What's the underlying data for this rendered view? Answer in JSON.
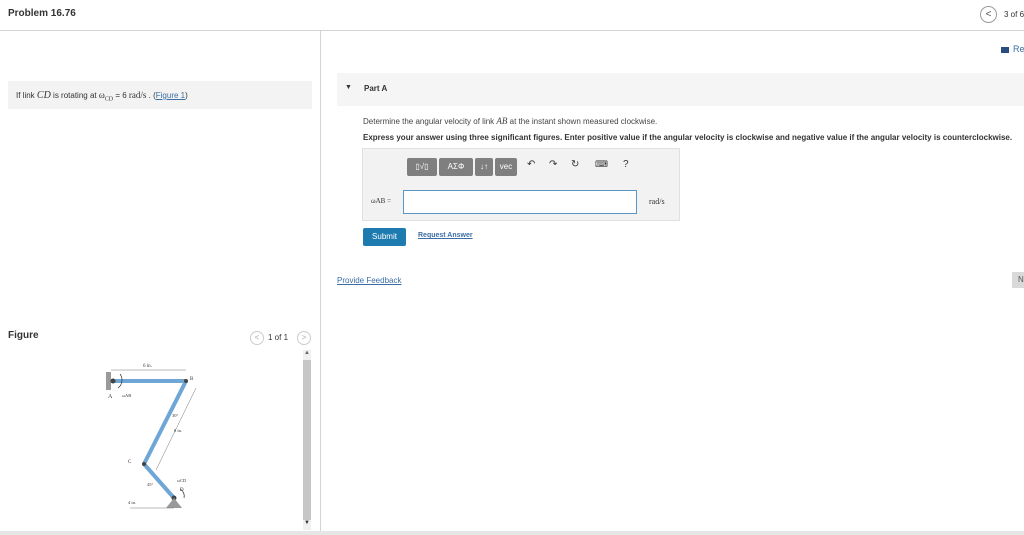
{
  "header": {
    "title": "Problem 16.76",
    "prev_label": "<",
    "pager": "3 of 6"
  },
  "review": {
    "label": "Review"
  },
  "prompt": {
    "p1": "If link ",
    "var1": "CD",
    "p2": " is rotating at ",
    "omega_sym": "ω",
    "omega_sub": "CD",
    "p3": " = 6 ",
    "units": "rad/s",
    "p4": " . (",
    "fig_link": "Figure 1",
    "p5": ")"
  },
  "figure_panel": {
    "label": "Figure",
    "prev": "<",
    "count": "1 of 1",
    "next": ">",
    "labels": {
      "dim_top": "6 in.",
      "A": "A",
      "omega_ab": "ωAB",
      "B": "B",
      "angle30": "30°",
      "dim_8": "8 in.",
      "C": "C",
      "angle45": "45°",
      "omega_cd": "ωCD",
      "D": "D",
      "dim_4": "4 in."
    }
  },
  "part": {
    "toggle": "▼",
    "title": "Part A",
    "question_pre": "Determine the angular velocity of link ",
    "question_var": "AB",
    "question_post": " at the instant shown measured clockwise.",
    "instructions": "Express your answer using three significant figures. Enter positive value if the angular velocity is clockwise and negative value if the angular velocity is counterclockwise.",
    "answer_label": "ωAB =",
    "answer_value": "",
    "units": "rad/s",
    "toolbar": {
      "templates": "▯√▯",
      "greek": "ΑΣΦ",
      "arrows": "↓↑",
      "vec": "vec",
      "undo": "↶",
      "redo": "↷",
      "reset": "↻",
      "keyboard": "⌨",
      "help": "?"
    },
    "submit": "Submit",
    "request": "Request Answer"
  },
  "footer": {
    "feedback": "Provide Feedback",
    "next": "Next >"
  }
}
